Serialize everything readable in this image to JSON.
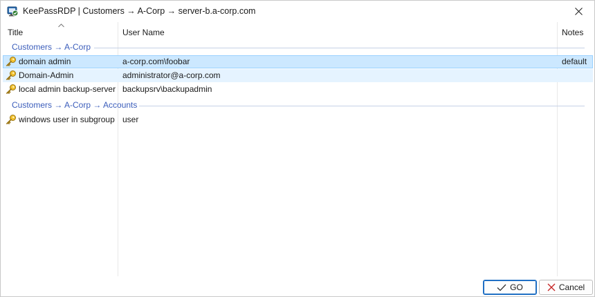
{
  "window": {
    "title": "KeePassRDP | Customers → A-Corp → server-b.a-corp.com",
    "app_icon": "keepassrdp-icon",
    "close_icon": "close-icon"
  },
  "list": {
    "columns": {
      "title": "Title",
      "username": "User Name",
      "notes": "Notes"
    },
    "sort_icon": "sort-ascending-icon",
    "groups": [
      {
        "label": "Customers → A-Corp"
      },
      {
        "label": "Customers → A-Corp → Accounts"
      }
    ],
    "entries": [
      {
        "title": "domain admin",
        "username": "a-corp.com\\foobar",
        "notes": "default",
        "state": "selected",
        "icon": "key-icon"
      },
      {
        "title": "Domain-Admin",
        "username": "administrator@a-corp.com",
        "notes": "",
        "state": "hover",
        "icon": "key-icon"
      },
      {
        "title": "local admin backup-server",
        "username": "backupsrv\\backupadmin",
        "notes": "",
        "state": "normal",
        "icon": "key-icon"
      },
      {
        "title": "windows user in subgroup",
        "username": "user",
        "notes": "",
        "state": "normal",
        "icon": "key-icon"
      }
    ]
  },
  "buttons": {
    "go": "GO",
    "go_icon": "checkmark-icon",
    "cancel": "Cancel",
    "cancel_icon": "cross-icon"
  },
  "colors": {
    "group_label": "#3b5dbb",
    "selection": "#cce8ff",
    "hover": "#e5f3ff",
    "default_button_border": "#1f6fc4"
  }
}
